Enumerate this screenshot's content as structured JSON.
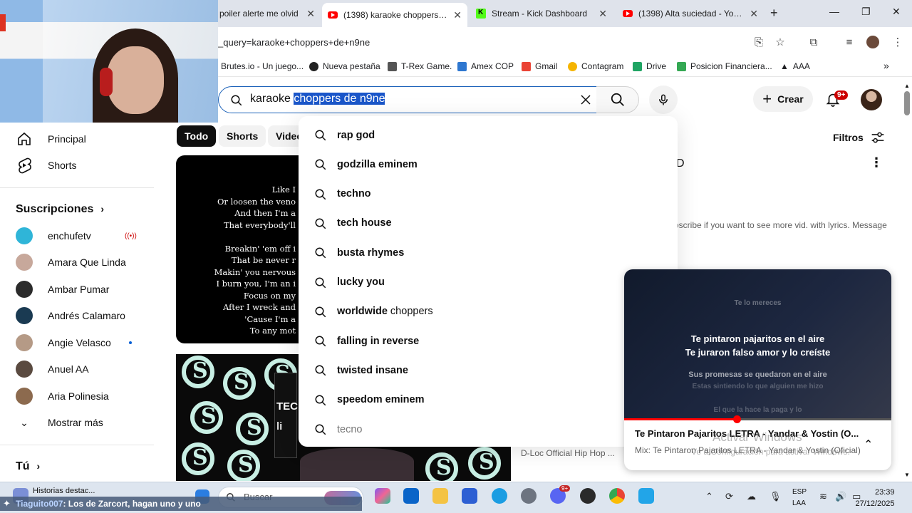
{
  "browser": {
    "tabs": [
      {
        "title": "poiler alerte me olvid",
        "active": false
      },
      {
        "title": "(1398) karaoke choppers de",
        "active": true
      },
      {
        "title": "Stream - Kick Dashboard",
        "active": false
      },
      {
        "title": "(1398) Alta suciedad - YouTu",
        "active": false
      }
    ],
    "new_tab": "+",
    "url": "_query=karaoke+choppers+de+n9ne",
    "bookmarks": [
      "Brutes.io - Un juego...",
      "Nueva pestaña",
      "T-Rex Game.",
      "Amex COP",
      "Gmail",
      "Contagram",
      "Drive",
      "Posicion Financiera...",
      "AAA"
    ],
    "bookmarks_more": "»"
  },
  "youtube": {
    "search": {
      "typed": "karaoke ",
      "selected": "choppers de n9ne"
    },
    "create_label": "Crear",
    "notification_count": "9+",
    "suggestions": [
      {
        "bold": "rap god",
        "light": ""
      },
      {
        "bold": "godzilla eminem",
        "light": ""
      },
      {
        "bold": "techno",
        "light": ""
      },
      {
        "bold": "tech house",
        "light": ""
      },
      {
        "bold": "busta rhymes",
        "light": ""
      },
      {
        "bold": "lucky you",
        "light": ""
      },
      {
        "bold": "worldwide",
        "light": " choppers"
      },
      {
        "bold": "falling in reverse",
        "light": ""
      },
      {
        "bold": "twisted insane",
        "light": ""
      },
      {
        "bold": "speedom eminem",
        "light": ""
      },
      {
        "bold": "",
        "light": "tecno",
        "history": true
      }
    ],
    "sidebar": {
      "main": [
        {
          "label": "Principal",
          "icon": "home-icon"
        },
        {
          "label": "Shorts",
          "icon": "shorts-icon"
        }
      ],
      "subscriptions_title": "Suscripciones",
      "subscriptions": [
        {
          "name": "enchufetv",
          "color": "#2fb5d8",
          "status": "live"
        },
        {
          "name": "Amara Que Linda",
          "color": "#c7a89b",
          "status": ""
        },
        {
          "name": "Ambar Pumar",
          "color": "#2b2b2b",
          "status": ""
        },
        {
          "name": "Andrés Calamaro",
          "color": "#1a3a52",
          "status": ""
        },
        {
          "name": "Angie Velasco",
          "color": "#b59a86",
          "status": "new"
        },
        {
          "name": "Anuel AA",
          "color": "#5a4a40",
          "status": ""
        },
        {
          "name": "Aria Polinesia",
          "color": "#8c6a4e",
          "status": ""
        }
      ],
      "show_more": "Mostrar más",
      "you_title": "Tú"
    },
    "chips": [
      "Todo",
      "Shorts",
      "Video"
    ],
    "filters_label": "Filtros",
    "result1": {
      "lyrics": [
        "Like I",
        "Or loosen the veno",
        "And then I'm a",
        "That everybody'll",
        "",
        "Breakin' 'em off i",
        "That be never r",
        "Makin' you nervous",
        "I burn you, I'm an i",
        "Focus on my",
        "After I wreck and",
        "'Cause I'm a",
        "To any mot"
      ],
      "title_fragment": "D",
      "desc_fragment": "bscribe if you want to see more vid. with lyrics. Message"
    },
    "result2": {
      "thumb_text_1": "TEC",
      "thumb_text_2": "li",
      "channel_fragment": "D-Loc Official Hip Hop ..."
    },
    "miniplayer": {
      "lyrics_top": "Te lo mereces",
      "lyrics_main_1": "Te pintaron pajaritos en el aire",
      "lyrics_main_2": "Te juraron falso amor y lo creíste",
      "lyrics_mid": "Sus promesas se quedaron en el aire",
      "lyrics_dim": "Estas sintiendo lo que alguien me hizo",
      "lyrics_bottom": "El que la hace la paga y lo",
      "title": "Te Pintaron Pajaritos LETRA - Yandar & Yostin (O...",
      "subtitle": "Mix: Te Pintaron Pajaritos LETRA - Yandar & Yostin (Oficial)",
      "progress": 0.42
    },
    "watermark_1": "Activar Windows",
    "watermark_2": "Ve a Configuración para activar Windows."
  },
  "taskbar": {
    "news": "Historias destac...",
    "search_placeholder": "Buscar",
    "lang_1": "ESP",
    "lang_2": "LAA",
    "time": "23:39",
    "date": "27/12/2025",
    "badge": "9+",
    "chat_user": "Tiaguito007",
    "chat_message": ": Los de Zarcort, hagan uno y uno"
  }
}
